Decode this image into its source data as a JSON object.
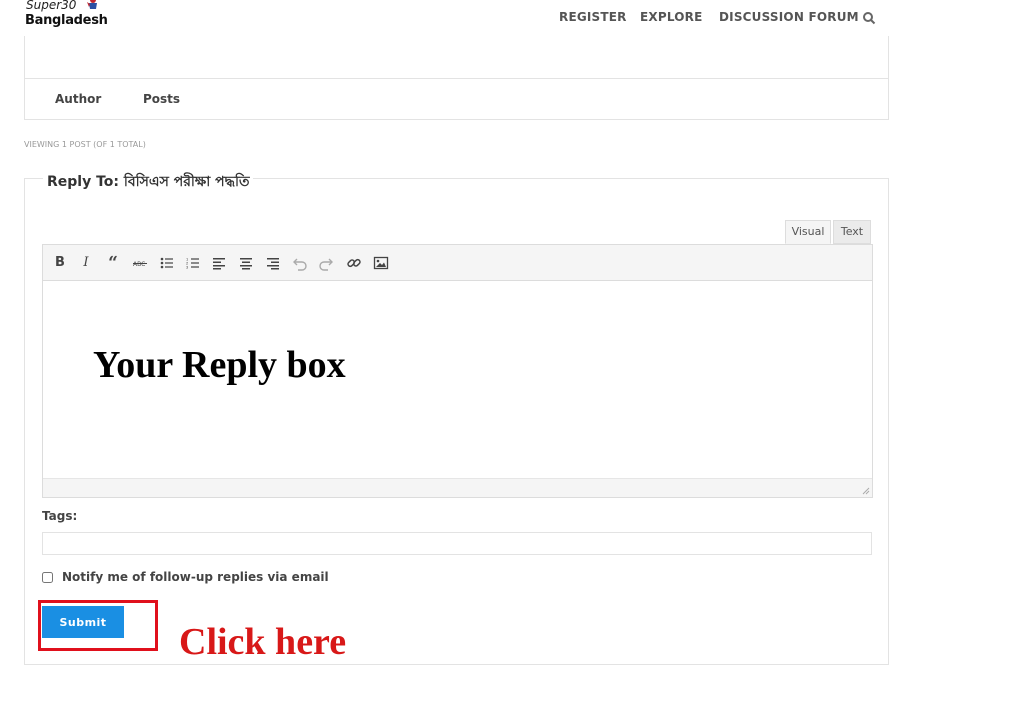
{
  "header": {
    "logo_top": "Super30",
    "logo_bottom": "Bangladesh",
    "nav": [
      "REGISTER",
      "EXPLORE",
      "DISCUSSION FORUM"
    ]
  },
  "table_head": {
    "author": "Author",
    "posts": "Posts"
  },
  "viewing": "Viewing 1 post (of 1 total)",
  "reply": {
    "legend": "Reply To: বিসিএস পরীক্ষা পদ্ধতি",
    "tabs": {
      "visual": "Visual",
      "text": "Text"
    },
    "toolbar_icons": [
      "bold-icon",
      "italic-icon",
      "blockquote-icon",
      "strikethrough-icon",
      "bullet-list-icon",
      "numbered-list-icon",
      "align-left-icon",
      "align-center-icon",
      "align-right-icon",
      "undo-icon",
      "redo-icon",
      "link-icon",
      "image-icon"
    ],
    "placeholder_text": "Your Reply box",
    "tags_label": "Tags:",
    "tags_value": "",
    "notify_label": "Notify me of follow-up replies via email",
    "notify_checked": false,
    "submit_label": "Submit"
  },
  "annotation": {
    "text": "Click here",
    "color": "#d81818"
  },
  "colors": {
    "accent": "#1a8fe3",
    "highlight": "#e0101c"
  }
}
